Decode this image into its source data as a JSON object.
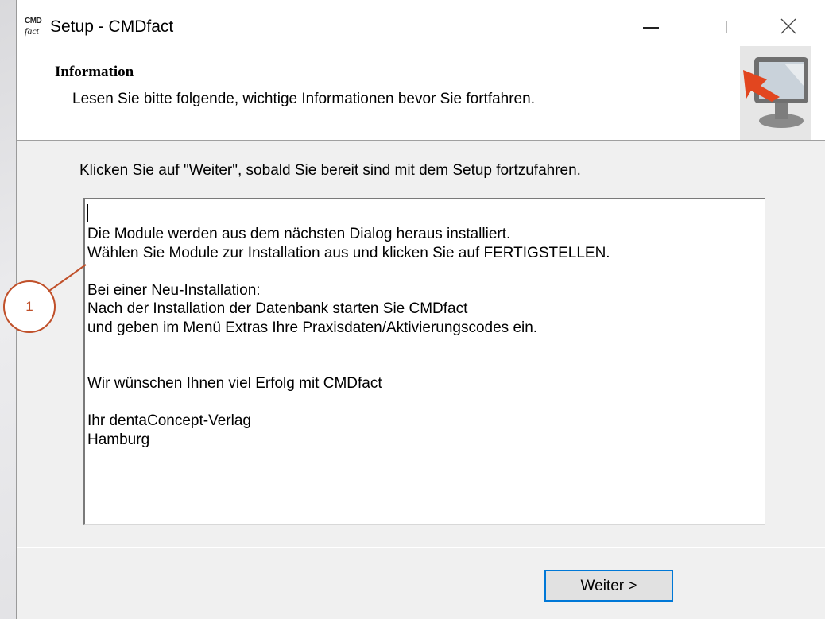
{
  "window": {
    "icon_text_top": "CMD",
    "icon_text_bottom": "fact",
    "title": "Setup - CMDfact"
  },
  "header": {
    "title": "Information",
    "subtitle": "Lesen Sie bitte folgende, wichtige Informationen bevor Sie fortfahren."
  },
  "body": {
    "instruction": "Klicken Sie auf \"Weiter\", sobald Sie bereit sind mit dem Setup fortzufahren.",
    "info_lines": [
      "Die Module werden aus dem nächsten Dialog heraus installiert.",
      "Wählen Sie Module zur Installation aus und klicken Sie auf FERTIGSTELLEN.",
      "",
      "Bei einer Neu-Installation:",
      "Nach der Installation der Datenbank starten Sie CMDfact",
      "und geben im Menü Extras Ihre Praxisdaten/Aktivierungscodes ein.",
      "",
      "",
      "Wir wünschen Ihnen viel Erfolg mit CMDfact",
      "",
      "Ihr dentaConcept-Verlag",
      "Hamburg"
    ]
  },
  "footer": {
    "next_label": "Weiter >"
  },
  "annotation": {
    "callout_number": "1",
    "color": "#c0502a"
  },
  "colors": {
    "focus_border": "#0078d7",
    "dialog_bg": "#f0f0f0",
    "header_bg": "#ffffff"
  }
}
